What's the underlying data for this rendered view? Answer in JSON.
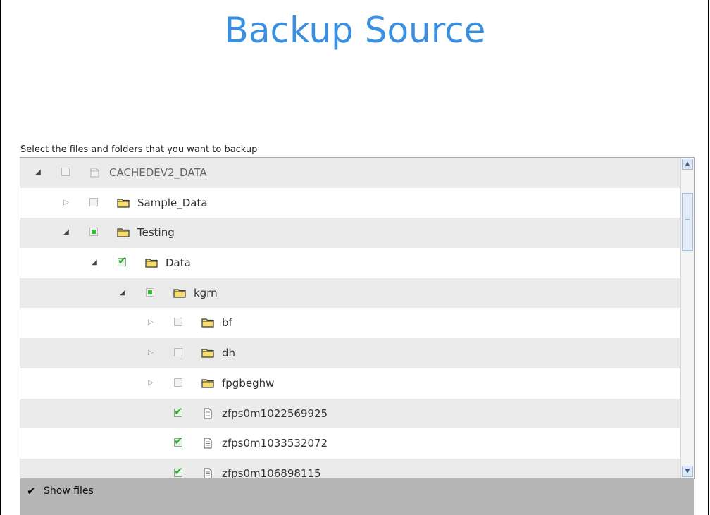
{
  "page": {
    "title": "Backup Source",
    "instruction": "Select the files and folders that you want to backup"
  },
  "tree": {
    "rows": [
      {
        "label": "CACHEDEV2_DATA",
        "level": 0,
        "expander": "expanded",
        "checkbox": "unchecked-disabled",
        "icon": "drive-icon",
        "muted": true
      },
      {
        "label": "Sample_Data",
        "level": 1,
        "expander": "collapsed",
        "checkbox": "unchecked",
        "icon": "folder-icon"
      },
      {
        "label": "Testing",
        "level": 1,
        "expander": "expanded",
        "checkbox": "partial",
        "icon": "folder-icon"
      },
      {
        "label": "Data",
        "level": 2,
        "expander": "expanded",
        "checkbox": "checked",
        "icon": "folder-icon"
      },
      {
        "label": "kgrn",
        "level": 3,
        "expander": "expanded",
        "checkbox": "partial",
        "icon": "folder-icon"
      },
      {
        "label": "bf",
        "level": 4,
        "expander": "collapsed",
        "checkbox": "unchecked",
        "icon": "folder-icon"
      },
      {
        "label": "dh",
        "level": 4,
        "expander": "collapsed",
        "checkbox": "unchecked",
        "icon": "folder-icon"
      },
      {
        "label": "fpgbeghw",
        "level": 4,
        "expander": "collapsed",
        "checkbox": "unchecked",
        "icon": "folder-icon"
      },
      {
        "label": "zfps0m1022569925",
        "level": 4,
        "expander": "none",
        "checkbox": "checked",
        "icon": "file-icon"
      },
      {
        "label": "zfps0m1033532072",
        "level": 4,
        "expander": "none",
        "checkbox": "checked",
        "icon": "file-icon"
      },
      {
        "label": "zfps0m106898115",
        "level": 4,
        "expander": "none",
        "checkbox": "checked",
        "icon": "file-icon"
      }
    ]
  },
  "footer": {
    "show_files_label": "Show files",
    "show_files_checked": true
  },
  "colors": {
    "title": "#3b8fe0",
    "row_alt": "#ebebeb",
    "check_green": "#31c131",
    "footer_bg": "#b5b5b5"
  }
}
